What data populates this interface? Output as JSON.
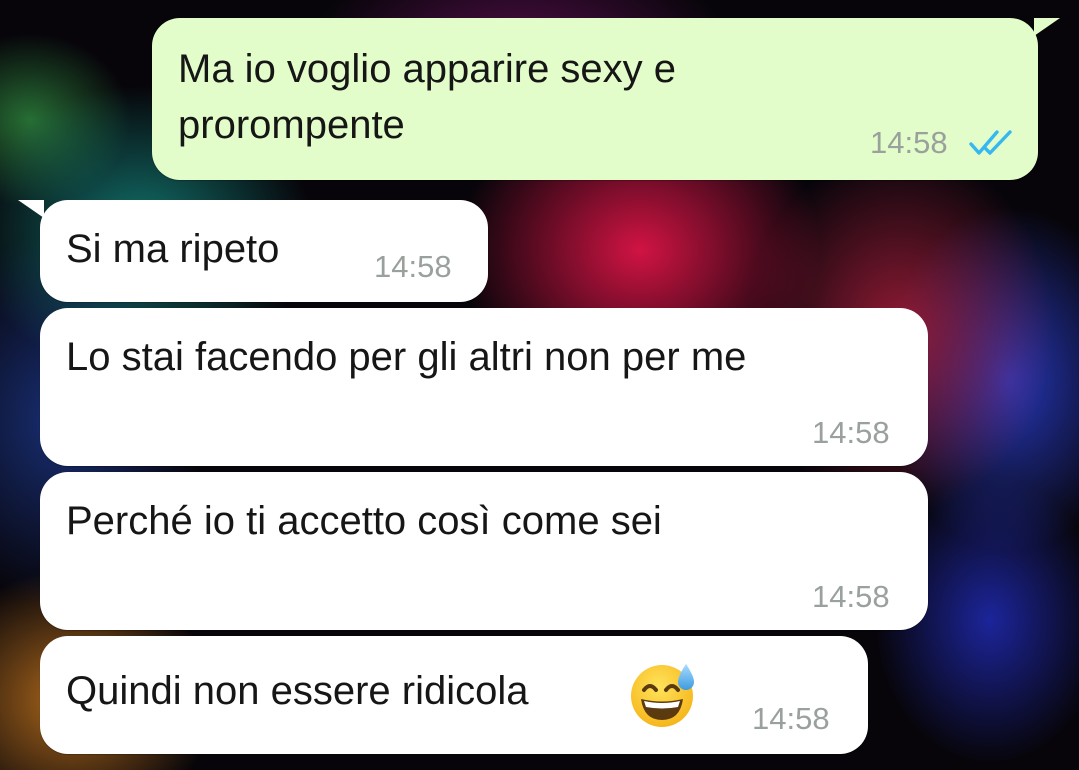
{
  "wallpaper": "colorful powder explosion on black background",
  "colors": {
    "outgoing_bubble": "#e2fdc9",
    "incoming_bubble": "#ffffff",
    "read_receipt": "#35b7f1",
    "timestamp": "#9aa19c"
  },
  "messages": [
    {
      "direction": "outgoing",
      "lines": [
        "Ma io voglio apparire sexy e",
        "prorompente"
      ],
      "time": "14:58",
      "status_icon": "double-check-read-icon"
    },
    {
      "direction": "incoming",
      "lines": [
        "Si ma ripeto"
      ],
      "time": "14:58"
    },
    {
      "direction": "incoming",
      "lines": [
        "Lo stai facendo per gli altri non per me"
      ],
      "time": "14:58"
    },
    {
      "direction": "incoming",
      "lines": [
        "Perché io ti accetto così come sei"
      ],
      "time": "14:58"
    },
    {
      "direction": "incoming",
      "lines": [
        "Quindi non essere ridicola"
      ],
      "time": "14:58",
      "emoji_icon": "grinning-face-with-sweat-icon"
    }
  ]
}
